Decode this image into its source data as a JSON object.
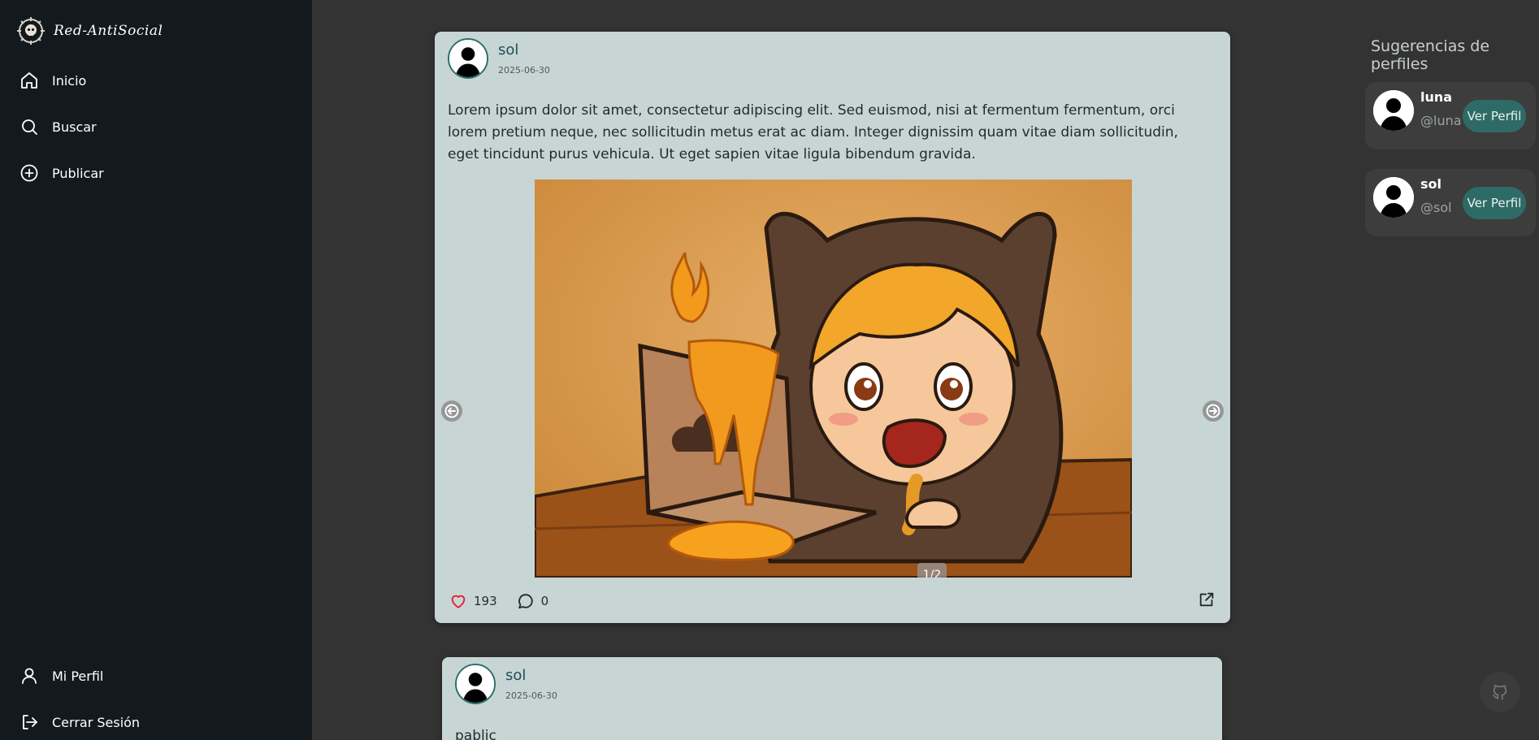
{
  "brand": {
    "name": "Red-AntiSocial",
    "logo": "skull-wheel-logo"
  },
  "nav": {
    "top": [
      {
        "label": "Inicio",
        "icon": "home-icon"
      },
      {
        "label": "Buscar",
        "icon": "search-icon"
      },
      {
        "label": "Publicar",
        "icon": "plus-circle-icon"
      }
    ],
    "bottom": [
      {
        "label": "Mi Perfil",
        "icon": "user-icon"
      },
      {
        "label": "Cerrar Sesión",
        "icon": "logout-icon"
      }
    ]
  },
  "posts": [
    {
      "author": "sol",
      "date": "2025-06-30",
      "text": "Lorem ipsum dolor sit amet, consectetur adipiscing elit. Sed euismod, nisi at fermentum fermentum, orci lorem pretium neque, nec sollicitudin metus erat ac diam. Integer dignissim quam vitae diam sollicitudin, eget tincidunt purus vehicula. Ut eget sapien vitae ligula bibendum gravida.",
      "media_counter": "1/2",
      "likes": "193",
      "comments": "0"
    },
    {
      "author": "sol",
      "date": "2025-06-30",
      "text": "pablic"
    }
  ],
  "suggestions": {
    "title": "Sugerencias de perfiles",
    "profiles": [
      {
        "name": "luna",
        "handle": "@luna",
        "button": "Ver Perfil"
      },
      {
        "name": "sol",
        "handle": "@sol",
        "button": "Ver Perfil"
      }
    ]
  },
  "colors": {
    "accent": "#2e6b66",
    "card": "#c8d5d5",
    "sidebar": "#121a1f",
    "like": "#e11d2a"
  },
  "floating": {
    "icon": "github-icon"
  }
}
